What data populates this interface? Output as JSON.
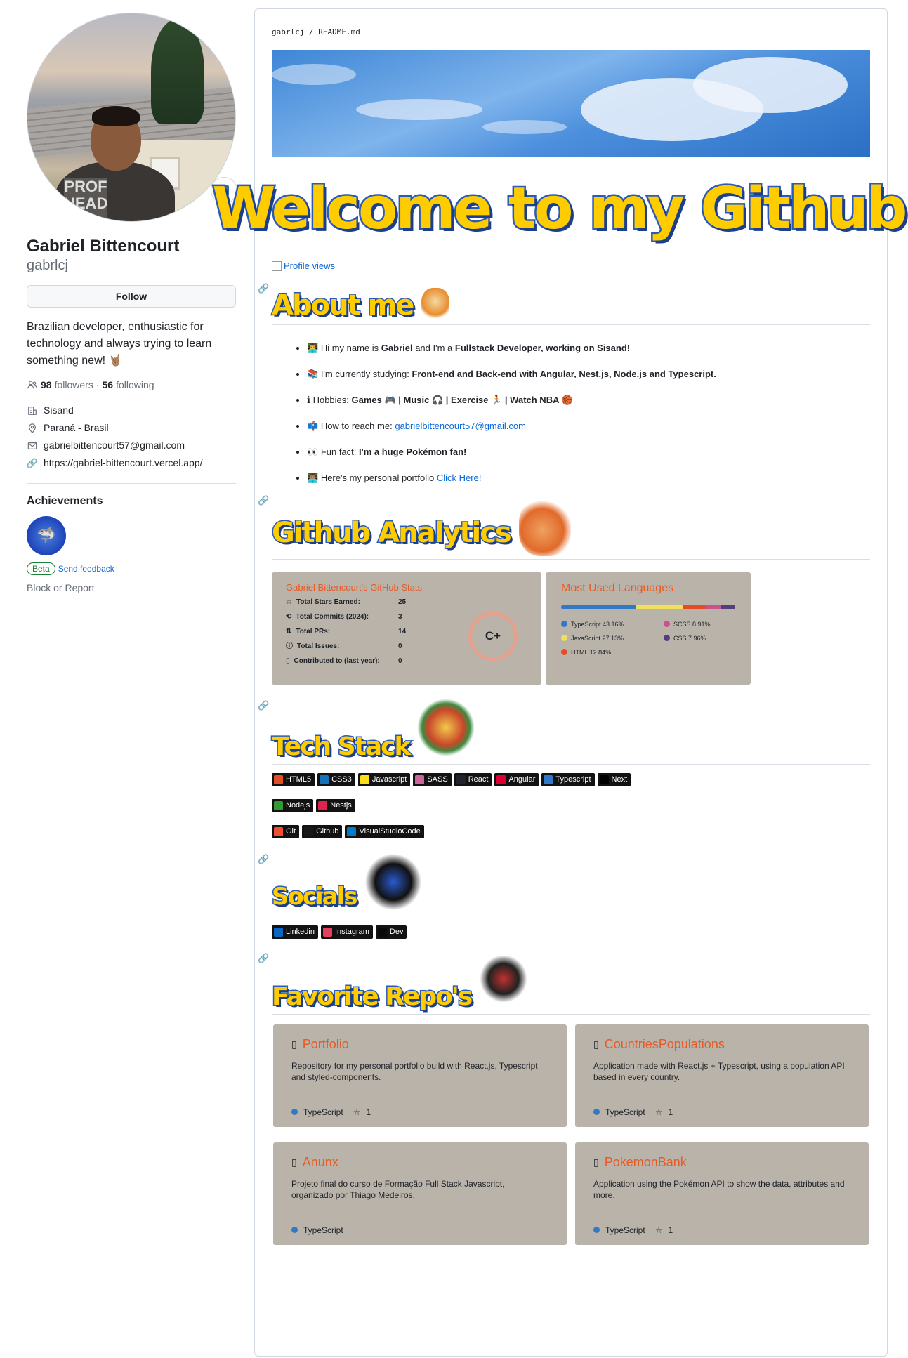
{
  "profile": {
    "name": "Gabriel Bittencourt",
    "login": "gabrlcj",
    "follow_label": "Follow",
    "bio": "Brazilian developer, enthusiastic for technology and always trying to learn something new! 🤘🏽",
    "followers_count": "98",
    "followers_label": "followers",
    "following_count": "56",
    "following_label": "following",
    "company": "Sisand",
    "location": "Paraná - Brasil",
    "email": "gabrielbittencourt57@gmail.com",
    "website": "https://gabriel-bittencourt.vercel.app/",
    "achievements_title": "Achievements",
    "beta_label": "Beta",
    "feedback_label": "Send feedback",
    "block_label": "Block or Report"
  },
  "readme": {
    "path_user": "gabrlcj",
    "path_sep": " / ",
    "path_file": "README.md",
    "welcome": "Welcome to my Github!",
    "profile_views_alt": "Profile views",
    "sections": {
      "about": "About me",
      "analytics": "Github Analytics",
      "tech": "Tech Stack",
      "socials": "Socials",
      "repos": "Favorite Repo's"
    },
    "about_items": [
      {
        "icon": "👨‍💻",
        "pre": "Hi my name is ",
        "b1": "Gabriel",
        "mid": " and I'm a ",
        "b2": "Fullstack Developer, working on Sisand!"
      },
      {
        "icon": "📚",
        "pre": "I'm currently studying: ",
        "b1": "Front-end and Back-end with Angular, Nest.js, Node.js and Typescript."
      },
      {
        "icon": "ℹ",
        "pre": "Hobbies: ",
        "b1": "Games 🎮 | Music 🎧 | Exercise 🏃 | Watch NBA 🏀"
      },
      {
        "icon": "📫",
        "pre": "How to reach me: ",
        "link": "gabrielbittencourt57@gmail.com"
      },
      {
        "icon": "👀",
        "pre": "Fun fact: ",
        "b1": "I'm a huge Pokémon fan!"
      },
      {
        "icon": "👨🏽‍💻",
        "pre": "Here's my personal portfolio ",
        "link": "Click Here!"
      }
    ],
    "stats_card": {
      "title": "Gabriel Bittencourt's GitHub Stats",
      "rows": [
        {
          "label": "Total Stars Earned:",
          "value": "25"
        },
        {
          "label": "Total Commits (2024):",
          "value": "3"
        },
        {
          "label": "Total PRs:",
          "value": "14"
        },
        {
          "label": "Total Issues:",
          "value": "0"
        },
        {
          "label": "Contributed to (last year):",
          "value": "0"
        }
      ],
      "grade": "C+"
    },
    "lang_card": {
      "title": "Most Used Languages",
      "langs": [
        {
          "name": "TypeScript 43.16%",
          "color": "#3178c6",
          "pct": 43.16
        },
        {
          "name": "SCSS 8.91%",
          "color": "#c6538c",
          "pct": 8.91
        },
        {
          "name": "JavaScript 27.13%",
          "color": "#f1e05a",
          "pct": 27.13
        },
        {
          "name": "CSS 7.96%",
          "color": "#563d7c",
          "pct": 7.96
        },
        {
          "name": "HTML 12.84%",
          "color": "#e34c26",
          "pct": 12.84
        }
      ]
    },
    "tech_rows": [
      [
        {
          "label": "HTML5",
          "color": "#e34f26"
        },
        {
          "label": "CSS3",
          "color": "#1572b6"
        },
        {
          "label": "Javascript",
          "color": "#f7df1e"
        },
        {
          "label": "SASS",
          "color": "#cc6699"
        },
        {
          "label": "React",
          "color": "#20232a"
        },
        {
          "label": "Angular",
          "color": "#dd0031"
        },
        {
          "label": "Typescript",
          "color": "#3178c6"
        },
        {
          "label": "Next",
          "color": "#000000"
        }
      ],
      [
        {
          "label": "Nodejs",
          "color": "#339933"
        },
        {
          "label": "Nestjs",
          "color": "#e0234e"
        }
      ],
      [
        {
          "label": "Git",
          "color": "#f05032"
        },
        {
          "label": "Github",
          "color": "#181717"
        },
        {
          "label": "VisualStudioCode",
          "color": "#007acc"
        }
      ]
    ],
    "socials": [
      {
        "label": "Linkedin",
        "color": "#0a66c2"
      },
      {
        "label": "Instagram",
        "color": "#e4405f"
      },
      {
        "label": "Dev",
        "color": "#0a0a0a"
      }
    ],
    "repos": [
      {
        "name": "Portfolio",
        "desc": "Repository for my personal portfolio build with React.js, Typescript and styled-components.",
        "lang": "TypeScript",
        "stars": "1"
      },
      {
        "name": "CountriesPopulations",
        "desc": "Application made with React.js + Typescript, using a population API based in every country.",
        "lang": "TypeScript",
        "stars": "1"
      },
      {
        "name": "Anunx",
        "desc": "Projeto final do curso de Formação Full Stack Javascript, organizado por Thiago Medeiros.",
        "lang": "TypeScript",
        "stars": ""
      },
      {
        "name": "PokemonBank",
        "desc": "Application using the Pokémon API to show the data, attributes and more.",
        "lang": "TypeScript",
        "stars": "1"
      }
    ]
  },
  "colors": {
    "accent": "#e85a24",
    "card_bg": "#b9b3aa",
    "ts_dot": "#3178c6"
  }
}
